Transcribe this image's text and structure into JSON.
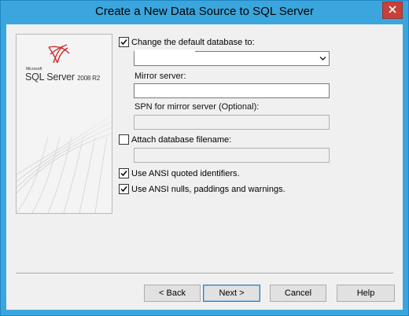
{
  "window": {
    "title": "Create a New Data Source to SQL Server"
  },
  "logo": {
    "vendor": "Microsoft",
    "product": "SQL Server",
    "version": "2008 R2",
    "accent_color": "#cc2a2a"
  },
  "options": {
    "change_default_db": {
      "label": "Change the default database to:",
      "checked": true,
      "value": ""
    },
    "mirror_server": {
      "label": "Mirror server:",
      "value": ""
    },
    "spn_mirror": {
      "label": "SPN for mirror server (Optional):",
      "value": ""
    },
    "attach_db": {
      "label": "Attach database filename:",
      "checked": false,
      "value": ""
    },
    "ansi_quoted": {
      "label": "Use ANSI quoted identifiers.",
      "checked": true
    },
    "ansi_nulls": {
      "label": "Use ANSI nulls, paddings and warnings.",
      "checked": true
    }
  },
  "buttons": {
    "back": "< Back",
    "next": "Next >",
    "cancel": "Cancel",
    "help": "Help"
  }
}
